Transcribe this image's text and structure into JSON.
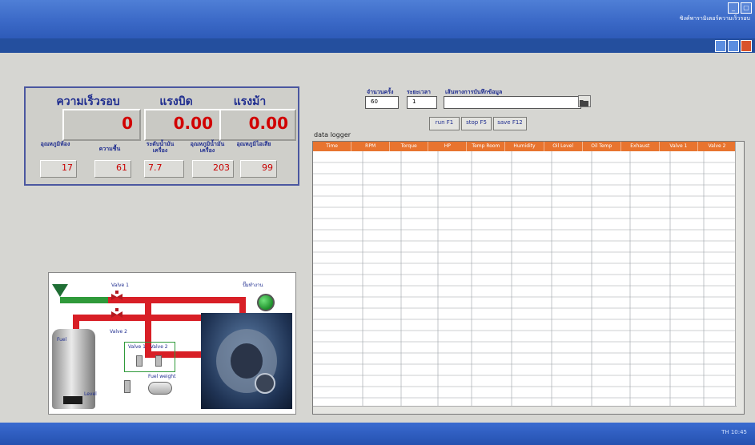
{
  "window": {
    "title_right_text": "ซิงค์พารามิเตอร์ความเร็วรอบ"
  },
  "gauges": {
    "speed": {
      "label": "ความเร็วรอบ",
      "value": "0"
    },
    "pressure": {
      "label": "แรงบิด",
      "value": "0.00"
    },
    "power": {
      "label": "แรงม้า",
      "value": "0.00"
    }
  },
  "sensors": [
    {
      "label": "อุณหภูมิห้อง",
      "value": "17"
    },
    {
      "label": "ความชื้น",
      "value": "61"
    },
    {
      "label": "ระดับน้ำมันเครื่อง",
      "value": "7.7"
    },
    {
      "label": "อุณหภูมิน้ำมันเครื่อง",
      "value": "203"
    },
    {
      "label": "อุณหภูมิไอเสีย",
      "value": "99"
    }
  ],
  "controls": {
    "sample_label": "จำนวนครั้ง",
    "sample_value": "60",
    "interval_label": "ระยะเวลา",
    "interval_value": "1",
    "path_label": "เส้นทางการบันทึกข้อมูล",
    "path_value": "",
    "buttons": [
      "run F1",
      "stop F5",
      "save F12"
    ]
  },
  "logger": {
    "title": "data logger",
    "columns": [
      "Time",
      "RPM",
      "Torque",
      "HP",
      "Temp Room",
      "Humidity",
      "Oil Level",
      "Oil Temp",
      "Exhaust",
      "Valve 1",
      "Valve 2"
    ]
  },
  "process": {
    "valve_top": "Valve 1",
    "valve_bottom": "Valve 2",
    "status_label": "ปั๊มทำงาน",
    "tank_label": "Fuel",
    "tank_bottom_label": "Level",
    "valve_box": "Valve 1   Valve 2",
    "fuel_weight": "Fuel weight"
  },
  "taskbar": {
    "tray_text": "TH 10:45"
  },
  "colors": {
    "accent_blue": "#1f2d8f",
    "value_red": "#d10000",
    "pipe_red": "#d81f26",
    "pipe_green": "#2f9a3a",
    "logger_header": "#e8742f"
  }
}
